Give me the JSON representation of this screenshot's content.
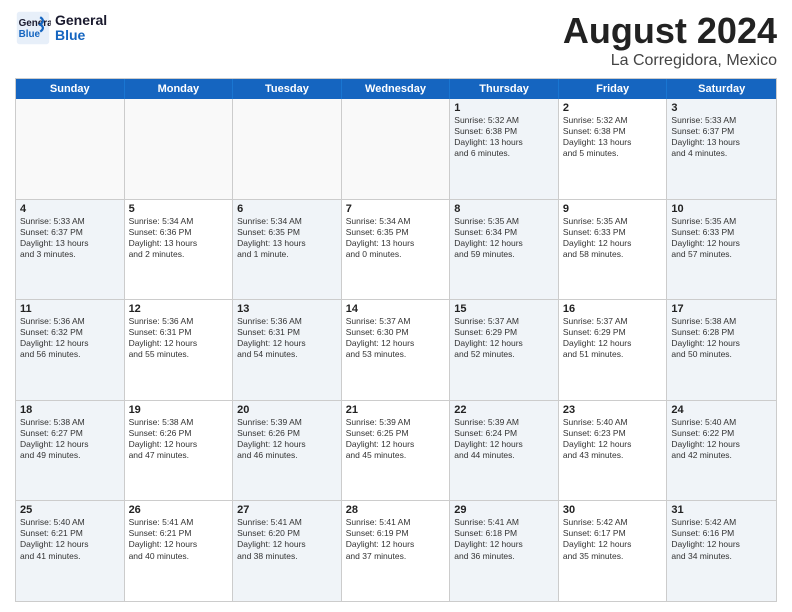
{
  "logo": {
    "line1": "General",
    "line2": "Blue"
  },
  "title": "August 2024",
  "subtitle": "La Corregidora, Mexico",
  "header": {
    "days": [
      "Sunday",
      "Monday",
      "Tuesday",
      "Wednesday",
      "Thursday",
      "Friday",
      "Saturday"
    ]
  },
  "weeks": [
    [
      {
        "day": "",
        "info": "",
        "empty": true
      },
      {
        "day": "",
        "info": "",
        "empty": true
      },
      {
        "day": "",
        "info": "",
        "empty": true
      },
      {
        "day": "",
        "info": "",
        "empty": true
      },
      {
        "day": "1",
        "info": "Sunrise: 5:32 AM\nSunset: 6:38 PM\nDaylight: 13 hours\nand 6 minutes.",
        "empty": false
      },
      {
        "day": "2",
        "info": "Sunrise: 5:32 AM\nSunset: 6:38 PM\nDaylight: 13 hours\nand 5 minutes.",
        "empty": false
      },
      {
        "day": "3",
        "info": "Sunrise: 5:33 AM\nSunset: 6:37 PM\nDaylight: 13 hours\nand 4 minutes.",
        "empty": false
      }
    ],
    [
      {
        "day": "4",
        "info": "Sunrise: 5:33 AM\nSunset: 6:37 PM\nDaylight: 13 hours\nand 3 minutes.",
        "empty": false
      },
      {
        "day": "5",
        "info": "Sunrise: 5:34 AM\nSunset: 6:36 PM\nDaylight: 13 hours\nand 2 minutes.",
        "empty": false
      },
      {
        "day": "6",
        "info": "Sunrise: 5:34 AM\nSunset: 6:35 PM\nDaylight: 13 hours\nand 1 minute.",
        "empty": false
      },
      {
        "day": "7",
        "info": "Sunrise: 5:34 AM\nSunset: 6:35 PM\nDaylight: 13 hours\nand 0 minutes.",
        "empty": false
      },
      {
        "day": "8",
        "info": "Sunrise: 5:35 AM\nSunset: 6:34 PM\nDaylight: 12 hours\nand 59 minutes.",
        "empty": false
      },
      {
        "day": "9",
        "info": "Sunrise: 5:35 AM\nSunset: 6:33 PM\nDaylight: 12 hours\nand 58 minutes.",
        "empty": false
      },
      {
        "day": "10",
        "info": "Sunrise: 5:35 AM\nSunset: 6:33 PM\nDaylight: 12 hours\nand 57 minutes.",
        "empty": false
      }
    ],
    [
      {
        "day": "11",
        "info": "Sunrise: 5:36 AM\nSunset: 6:32 PM\nDaylight: 12 hours\nand 56 minutes.",
        "empty": false
      },
      {
        "day": "12",
        "info": "Sunrise: 5:36 AM\nSunset: 6:31 PM\nDaylight: 12 hours\nand 55 minutes.",
        "empty": false
      },
      {
        "day": "13",
        "info": "Sunrise: 5:36 AM\nSunset: 6:31 PM\nDaylight: 12 hours\nand 54 minutes.",
        "empty": false
      },
      {
        "day": "14",
        "info": "Sunrise: 5:37 AM\nSunset: 6:30 PM\nDaylight: 12 hours\nand 53 minutes.",
        "empty": false
      },
      {
        "day": "15",
        "info": "Sunrise: 5:37 AM\nSunset: 6:29 PM\nDaylight: 12 hours\nand 52 minutes.",
        "empty": false
      },
      {
        "day": "16",
        "info": "Sunrise: 5:37 AM\nSunset: 6:29 PM\nDaylight: 12 hours\nand 51 minutes.",
        "empty": false
      },
      {
        "day": "17",
        "info": "Sunrise: 5:38 AM\nSunset: 6:28 PM\nDaylight: 12 hours\nand 50 minutes.",
        "empty": false
      }
    ],
    [
      {
        "day": "18",
        "info": "Sunrise: 5:38 AM\nSunset: 6:27 PM\nDaylight: 12 hours\nand 49 minutes.",
        "empty": false
      },
      {
        "day": "19",
        "info": "Sunrise: 5:38 AM\nSunset: 6:26 PM\nDaylight: 12 hours\nand 47 minutes.",
        "empty": false
      },
      {
        "day": "20",
        "info": "Sunrise: 5:39 AM\nSunset: 6:26 PM\nDaylight: 12 hours\nand 46 minutes.",
        "empty": false
      },
      {
        "day": "21",
        "info": "Sunrise: 5:39 AM\nSunset: 6:25 PM\nDaylight: 12 hours\nand 45 minutes.",
        "empty": false
      },
      {
        "day": "22",
        "info": "Sunrise: 5:39 AM\nSunset: 6:24 PM\nDaylight: 12 hours\nand 44 minutes.",
        "empty": false
      },
      {
        "day": "23",
        "info": "Sunrise: 5:40 AM\nSunset: 6:23 PM\nDaylight: 12 hours\nand 43 minutes.",
        "empty": false
      },
      {
        "day": "24",
        "info": "Sunrise: 5:40 AM\nSunset: 6:22 PM\nDaylight: 12 hours\nand 42 minutes.",
        "empty": false
      }
    ],
    [
      {
        "day": "25",
        "info": "Sunrise: 5:40 AM\nSunset: 6:21 PM\nDaylight: 12 hours\nand 41 minutes.",
        "empty": false
      },
      {
        "day": "26",
        "info": "Sunrise: 5:41 AM\nSunset: 6:21 PM\nDaylight: 12 hours\nand 40 minutes.",
        "empty": false
      },
      {
        "day": "27",
        "info": "Sunrise: 5:41 AM\nSunset: 6:20 PM\nDaylight: 12 hours\nand 38 minutes.",
        "empty": false
      },
      {
        "day": "28",
        "info": "Sunrise: 5:41 AM\nSunset: 6:19 PM\nDaylight: 12 hours\nand 37 minutes.",
        "empty": false
      },
      {
        "day": "29",
        "info": "Sunrise: 5:41 AM\nSunset: 6:18 PM\nDaylight: 12 hours\nand 36 minutes.",
        "empty": false
      },
      {
        "day": "30",
        "info": "Sunrise: 5:42 AM\nSunset: 6:17 PM\nDaylight: 12 hours\nand 35 minutes.",
        "empty": false
      },
      {
        "day": "31",
        "info": "Sunrise: 5:42 AM\nSunset: 6:16 PM\nDaylight: 12 hours\nand 34 minutes.",
        "empty": false
      }
    ]
  ]
}
